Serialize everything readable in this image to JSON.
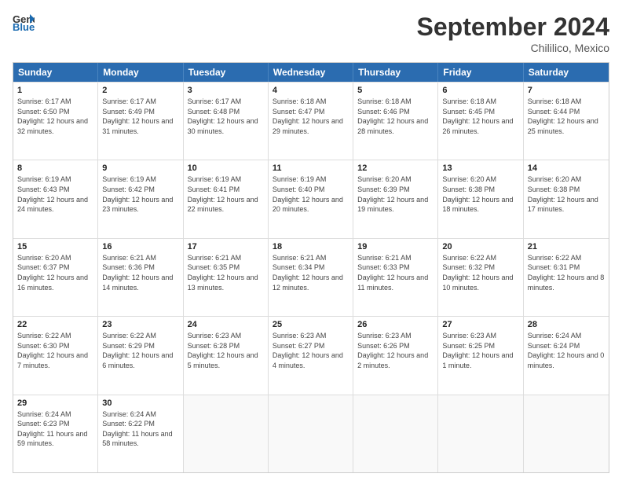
{
  "header": {
    "logo_line1": "General",
    "logo_line2": "Blue",
    "month": "September 2024",
    "location": "Chililico, Mexico"
  },
  "days_of_week": [
    "Sunday",
    "Monday",
    "Tuesday",
    "Wednesday",
    "Thursday",
    "Friday",
    "Saturday"
  ],
  "weeks": [
    [
      {
        "day": "1",
        "sunrise": "6:17 AM",
        "sunset": "6:50 PM",
        "daylight": "12 hours and 32 minutes."
      },
      {
        "day": "2",
        "sunrise": "6:17 AM",
        "sunset": "6:49 PM",
        "daylight": "12 hours and 31 minutes."
      },
      {
        "day": "3",
        "sunrise": "6:17 AM",
        "sunset": "6:48 PM",
        "daylight": "12 hours and 30 minutes."
      },
      {
        "day": "4",
        "sunrise": "6:18 AM",
        "sunset": "6:47 PM",
        "daylight": "12 hours and 29 minutes."
      },
      {
        "day": "5",
        "sunrise": "6:18 AM",
        "sunset": "6:46 PM",
        "daylight": "12 hours and 28 minutes."
      },
      {
        "day": "6",
        "sunrise": "6:18 AM",
        "sunset": "6:45 PM",
        "daylight": "12 hours and 26 minutes."
      },
      {
        "day": "7",
        "sunrise": "6:18 AM",
        "sunset": "6:44 PM",
        "daylight": "12 hours and 25 minutes."
      }
    ],
    [
      {
        "day": "8",
        "sunrise": "6:19 AM",
        "sunset": "6:43 PM",
        "daylight": "12 hours and 24 minutes."
      },
      {
        "day": "9",
        "sunrise": "6:19 AM",
        "sunset": "6:42 PM",
        "daylight": "12 hours and 23 minutes."
      },
      {
        "day": "10",
        "sunrise": "6:19 AM",
        "sunset": "6:41 PM",
        "daylight": "12 hours and 22 minutes."
      },
      {
        "day": "11",
        "sunrise": "6:19 AM",
        "sunset": "6:40 PM",
        "daylight": "12 hours and 20 minutes."
      },
      {
        "day": "12",
        "sunrise": "6:20 AM",
        "sunset": "6:39 PM",
        "daylight": "12 hours and 19 minutes."
      },
      {
        "day": "13",
        "sunrise": "6:20 AM",
        "sunset": "6:38 PM",
        "daylight": "12 hours and 18 minutes."
      },
      {
        "day": "14",
        "sunrise": "6:20 AM",
        "sunset": "6:38 PM",
        "daylight": "12 hours and 17 minutes."
      }
    ],
    [
      {
        "day": "15",
        "sunrise": "6:20 AM",
        "sunset": "6:37 PM",
        "daylight": "12 hours and 16 minutes."
      },
      {
        "day": "16",
        "sunrise": "6:21 AM",
        "sunset": "6:36 PM",
        "daylight": "12 hours and 14 minutes."
      },
      {
        "day": "17",
        "sunrise": "6:21 AM",
        "sunset": "6:35 PM",
        "daylight": "12 hours and 13 minutes."
      },
      {
        "day": "18",
        "sunrise": "6:21 AM",
        "sunset": "6:34 PM",
        "daylight": "12 hours and 12 minutes."
      },
      {
        "day": "19",
        "sunrise": "6:21 AM",
        "sunset": "6:33 PM",
        "daylight": "12 hours and 11 minutes."
      },
      {
        "day": "20",
        "sunrise": "6:22 AM",
        "sunset": "6:32 PM",
        "daylight": "12 hours and 10 minutes."
      },
      {
        "day": "21",
        "sunrise": "6:22 AM",
        "sunset": "6:31 PM",
        "daylight": "12 hours and 8 minutes."
      }
    ],
    [
      {
        "day": "22",
        "sunrise": "6:22 AM",
        "sunset": "6:30 PM",
        "daylight": "12 hours and 7 minutes."
      },
      {
        "day": "23",
        "sunrise": "6:22 AM",
        "sunset": "6:29 PM",
        "daylight": "12 hours and 6 minutes."
      },
      {
        "day": "24",
        "sunrise": "6:23 AM",
        "sunset": "6:28 PM",
        "daylight": "12 hours and 5 minutes."
      },
      {
        "day": "25",
        "sunrise": "6:23 AM",
        "sunset": "6:27 PM",
        "daylight": "12 hours and 4 minutes."
      },
      {
        "day": "26",
        "sunrise": "6:23 AM",
        "sunset": "6:26 PM",
        "daylight": "12 hours and 2 minutes."
      },
      {
        "day": "27",
        "sunrise": "6:23 AM",
        "sunset": "6:25 PM",
        "daylight": "12 hours and 1 minute."
      },
      {
        "day": "28",
        "sunrise": "6:24 AM",
        "sunset": "6:24 PM",
        "daylight": "12 hours and 0 minutes."
      }
    ],
    [
      {
        "day": "29",
        "sunrise": "6:24 AM",
        "sunset": "6:23 PM",
        "daylight": "11 hours and 59 minutes."
      },
      {
        "day": "30",
        "sunrise": "6:24 AM",
        "sunset": "6:22 PM",
        "daylight": "11 hours and 58 minutes."
      },
      null,
      null,
      null,
      null,
      null
    ]
  ]
}
